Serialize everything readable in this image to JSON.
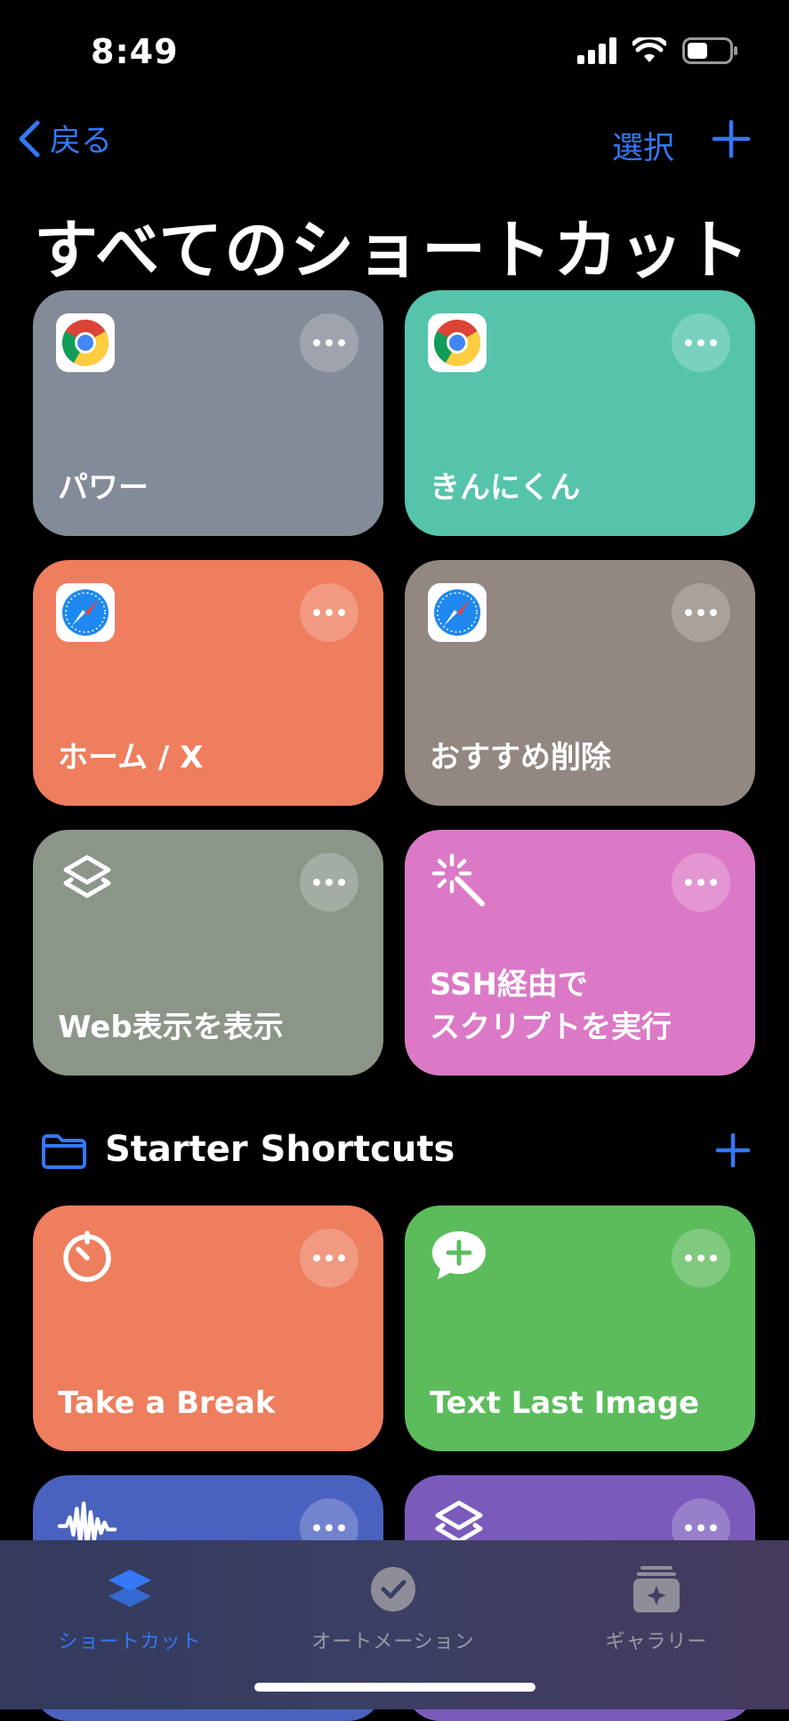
{
  "status": {
    "time": "8:49"
  },
  "nav": {
    "back_label": "戻る",
    "select_label": "選択"
  },
  "title": "すべてのショートカット",
  "shortcuts": [
    {
      "label": "パワー",
      "color": "#838a98",
      "icon": "chrome-icon"
    },
    {
      "label": "きんにくん",
      "color": "#55c4ab",
      "icon": "chrome-icon"
    },
    {
      "label": "ホーム / X",
      "color": "#ee7e5e",
      "icon": "safari-icon"
    },
    {
      "label": "おすすめ削除",
      "color": "#928781",
      "icon": "safari-icon"
    },
    {
      "label": "Web表示を表示",
      "color": "#8b9689",
      "icon": "layers-icon"
    },
    {
      "label": "SSH経由で\nスクリプトを実行",
      "color": "#db79c6",
      "icon": "magic-wand-icon"
    }
  ],
  "folder": {
    "title": "Starter Shortcuts"
  },
  "starter_shortcuts": [
    {
      "label": "Take a Break",
      "color": "#ee7e5e",
      "icon": "timer-icon"
    },
    {
      "label": "Text Last Image",
      "color": "#5cbc5c",
      "icon": "message-plus-icon"
    },
    {
      "label": "",
      "color": "#4a62bf",
      "icon": "waveform-icon"
    },
    {
      "label": "",
      "color": "#7a5bbb",
      "icon": "layers-icon"
    }
  ],
  "tabs": [
    {
      "label": "ショートカット",
      "active": true,
      "color": "#3478f6"
    },
    {
      "label": "オートメーション",
      "active": false,
      "color": "#8e8e99"
    },
    {
      "label": "ギャラリー",
      "active": false,
      "color": "#8e8e99"
    }
  ]
}
